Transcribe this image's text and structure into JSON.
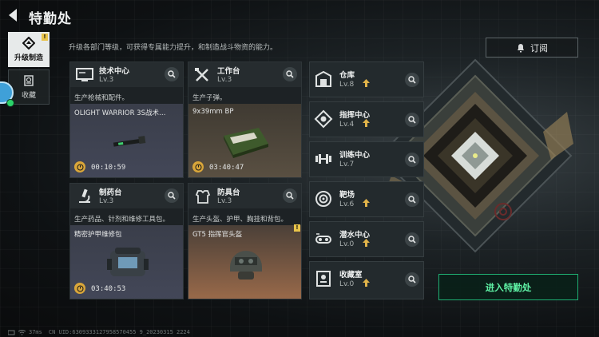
{
  "header": {
    "title": "特勤处"
  },
  "rail": {
    "tabs": [
      {
        "label": "升级制造",
        "icon": "upgrade-craft-icon",
        "badge": "!"
      },
      {
        "label": "收藏",
        "icon": "collection-icon"
      }
    ]
  },
  "subtitle": "升级各部门等级，可获得专属能力提升，和制造战斗物资的能力。",
  "subscribe_label": "订阅",
  "cards": [
    {
      "name": "技术中心",
      "level": "Lv.3",
      "desc": "生产枪械和配件。",
      "item": "OLIGHT WARRIOR 3S战术…",
      "timer": "00:10:59",
      "icon": "monitor-icon"
    },
    {
      "name": "工作台",
      "level": "Lv.3",
      "desc": "生产子弹。",
      "item": "9x39mm BP",
      "timer": "03:40:47",
      "icon": "tools-icon"
    },
    {
      "name": "制药台",
      "level": "Lv.3",
      "desc": "生产药品、针剂和维修工具包。",
      "item": "精密护甲维修包",
      "timer": "03:40:53",
      "icon": "microscope-icon"
    },
    {
      "name": "防具台",
      "level": "Lv.3",
      "desc": "生产头盔、护甲、胸挂和背包。",
      "item": "GT5 指挥官头盔",
      "badge": "!",
      "icon": "armor-icon"
    }
  ],
  "side_items": [
    {
      "name": "仓库",
      "level": "Lv.8",
      "icon": "warehouse-icon"
    },
    {
      "name": "指挥中心",
      "level": "Lv.4",
      "icon": "command-icon"
    },
    {
      "name": "训练中心",
      "level": "Lv.7",
      "icon": "dumbbell-icon"
    },
    {
      "name": "靶场",
      "level": "Lv.6",
      "icon": "target-icon"
    },
    {
      "name": "潜水中心",
      "level": "Lv.0",
      "icon": "dive-icon"
    },
    {
      "name": "收藏室",
      "level": "Lv.0",
      "icon": "trophy-icon"
    }
  ],
  "enter_label": "进入特勤处",
  "status": {
    "ping": "37ms",
    "uid": "CN UID:6309333127958570455 9_20230315 2224"
  },
  "colors": {
    "accent_green": "#5ef0a4",
    "timer_yellow": "#d9a63a",
    "badge_yellow": "#e9c44a",
    "level_up_yellow": "#e0b34a"
  }
}
